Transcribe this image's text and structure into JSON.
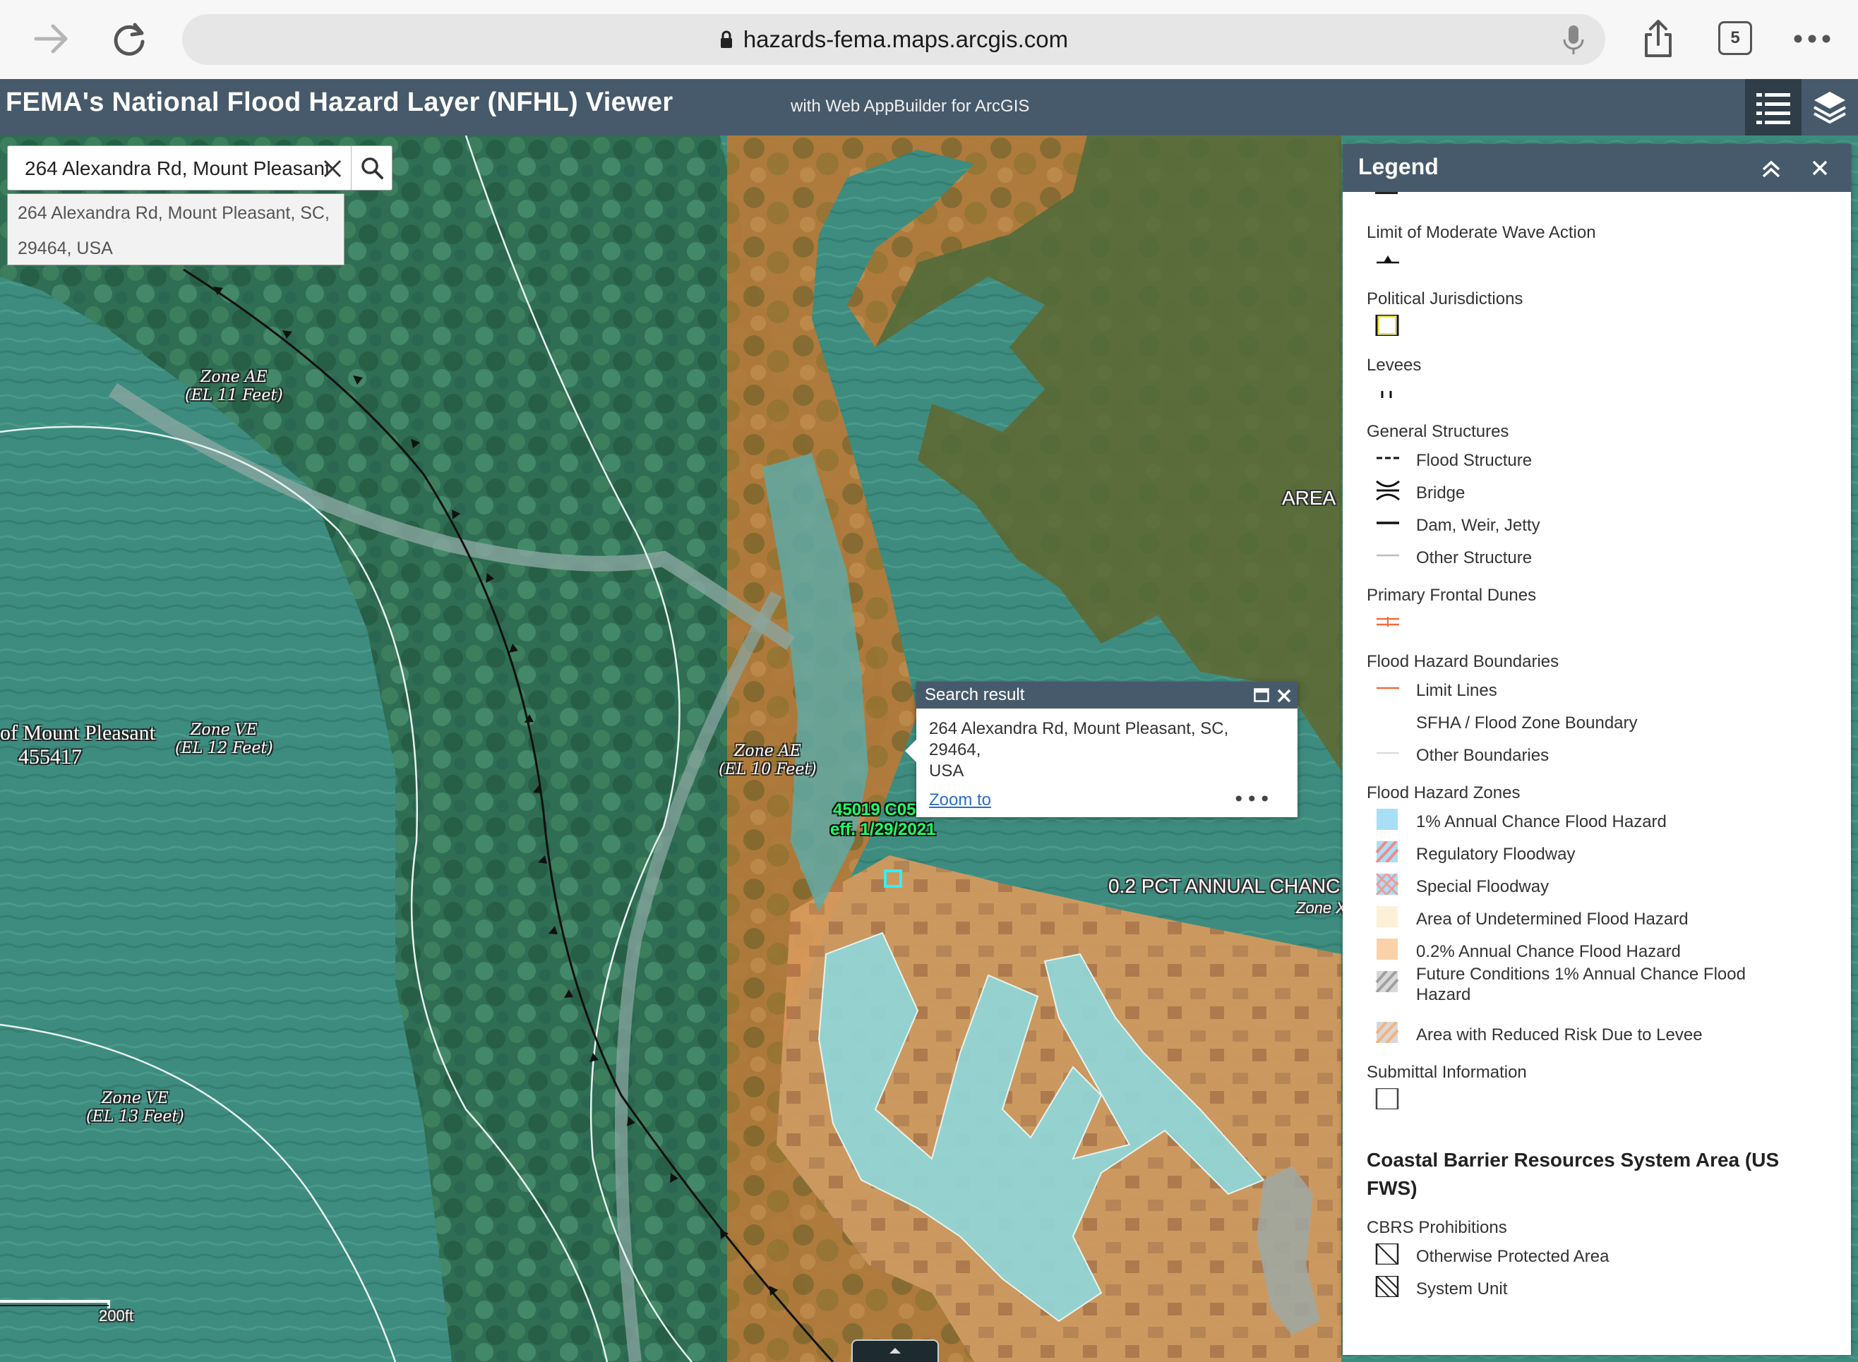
{
  "browser": {
    "url": "hazards-fema.maps.arcgis.com",
    "tab_count": "5"
  },
  "app": {
    "title": "FEMA's National Flood Hazard Layer (NFHL) Viewer",
    "subtitle": "with Web AppBuilder for ArcGIS"
  },
  "search": {
    "value": "264 Alexandra Rd, Mount Pleasant, SC, 29464, USA",
    "suggestion_line1": "264 Alexandra Rd, Mount Pleasant, SC,",
    "suggestion_line2": "29464, USA"
  },
  "map": {
    "labels": {
      "zone_ae_11_a": "Zone AE",
      "zone_ae_11_b": "(EL 11 Feet)",
      "zone_ve_12_a": "Zone VE",
      "zone_ve_12_b": "(EL 12 Feet)",
      "zone_ae_10_a": "Zone AE",
      "zone_ae_10_b": "(EL 10 Feet)",
      "zone_ve_13_a": "Zone VE",
      "zone_ve_13_b": "(EL 13 Feet)",
      "community_a": "of Mount Pleasant",
      "community_b": "455417",
      "panel_a": "45019 C05",
      "panel_b": "eff. 1/29/2021",
      "pct_annual": "0.2 PCT ANNUAL CHANC",
      "zone_x": "Zone X",
      "area": "AREA",
      "scale": "200ft"
    },
    "colors": {
      "ae_zone": "#3a8f8a",
      "shaded_x": "#c98a3d",
      "floodplain": "#8fd8dc"
    }
  },
  "popup": {
    "title": "Search result",
    "address_line1": "264 Alexandra Rd, Mount Pleasant, SC, 29464,",
    "address_line2": "USA",
    "zoom_link": "Zoom to",
    "more": "•••"
  },
  "legend": {
    "title": "Legend",
    "limit_wave": "Limit of Moderate Wave Action",
    "political": "Political Jurisdictions",
    "levees": "Levees",
    "general_structures": "General Structures",
    "flood_structure": "Flood Structure",
    "bridge": "Bridge",
    "dam": "Dam, Weir, Jetty",
    "other_structure": "Other Structure",
    "primary_dunes": "Primary Frontal Dunes",
    "boundaries": "Flood Hazard Boundaries",
    "limit_lines": "Limit Lines",
    "sfha_boundary": "SFHA / Flood Zone Boundary",
    "other_boundaries": "Other Boundaries",
    "zones": "Flood Hazard Zones",
    "zone_1pct": "1% Annual Chance Flood Hazard",
    "regulatory": "Regulatory Floodway",
    "special": "Special Floodway",
    "undetermined": "Area of Undetermined Flood Hazard",
    "zone_02pct": "0.2% Annual Chance Flood Hazard",
    "future_1": "Future Conditions 1% Annual Chance Flood",
    "future_2": "Hazard",
    "levee_risk": "Area with Reduced Risk Due to Levee",
    "submittal": "Submittal Information",
    "cbrs_heading": "Coastal Barrier Resources System Area (US FWS)",
    "cbrs_prohibitions": "CBRS Prohibitions",
    "otherwise_protected": "Otherwise Protected Area",
    "system_unit": "System Unit"
  }
}
